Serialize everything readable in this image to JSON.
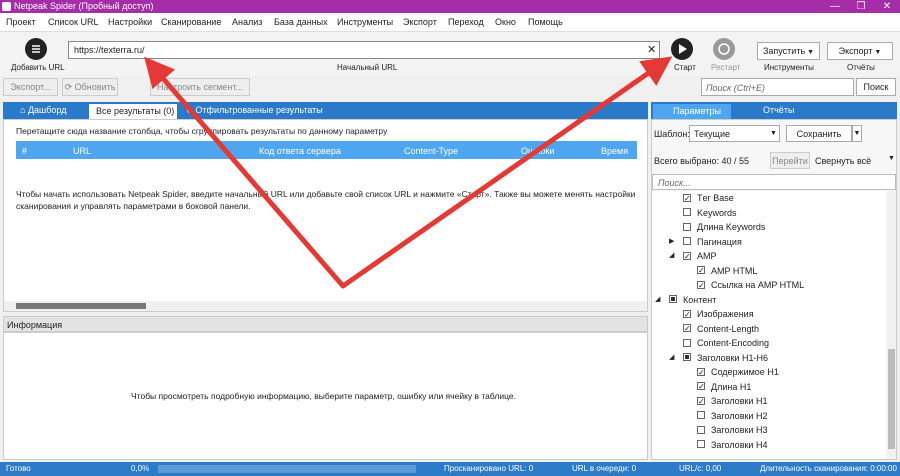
{
  "window": {
    "title": "Netpeak Spider (Пробный доступ)",
    "controls": [
      "—",
      "❐",
      "✕"
    ]
  },
  "menu": [
    "Проект",
    "Список URL",
    "Настройки",
    "Сканирование",
    "Анализ",
    "База данных",
    "Инструменты",
    "Экспорт",
    "Переход",
    "Окно",
    "Помощь"
  ],
  "toolbar": {
    "add_url": "Добавить URL",
    "url_value": "https://texterra.ru/",
    "url_caption": "Начальный URL",
    "start": "Старт",
    "restart": "Рестарт",
    "run": "Запустить",
    "tools": "Инструменты",
    "export": "Экспорт",
    "reports": "Отчёты"
  },
  "sub_toolbar": {
    "export": "Экспорт...",
    "update": "Обновить",
    "configure": "Настроить сегмент..."
  },
  "search": {
    "placeholder": "Поиск (Ctrl+E)",
    "button": "Поиск"
  },
  "left_tabs": {
    "dashboard": "Дашборд",
    "all_results": "Все результаты (0)",
    "filtered": "Отфильтрованные результаты"
  },
  "group_hint": "Перетащите сюда название столбца, чтобы сгруппировать результаты по данному параметру",
  "columns": [
    "#",
    "URL",
    "Код ответа сервера",
    "Content-Type",
    "Ошибки",
    "Время от"
  ],
  "empty_message": "Чтобы начать использовать Netpeak Spider, введите начальный URL или добавьте свой список URL и нажмите «Старт». Также вы можете менять настройки сканирования и управлять параметрами в боковой панели.",
  "info": {
    "title": "Информация",
    "message": "Чтобы просмотреть подробную информацию, выберите параметр, ошибку или ячейку в таблице."
  },
  "right_panel": {
    "tab_params": "Параметры",
    "tab_reports": "Отчёты",
    "template_label": "Шаблон:",
    "template_value": "Текущие",
    "save": "Сохранить",
    "selected": "Всего выбрано: 40 / 55",
    "go": "Перейти",
    "collapse": "Свернуть всё",
    "search_placeholder": "Поиск..."
  },
  "tree": [
    {
      "label": "Tег Base",
      "state": "on",
      "indent": 1,
      "arrow": ""
    },
    {
      "label": "Keywords",
      "state": "off",
      "indent": 1,
      "arrow": ""
    },
    {
      "label": "Длина Keywords",
      "state": "off",
      "indent": 1,
      "arrow": ""
    },
    {
      "label": "Пагинация",
      "state": "off",
      "indent": 1,
      "arrow": "▶"
    },
    {
      "label": "AMP",
      "state": "on",
      "indent": 1,
      "arrow": "◢"
    },
    {
      "label": "AMP HTML",
      "state": "on",
      "indent": 2,
      "arrow": ""
    },
    {
      "label": "Ссылка на AMP HTML",
      "state": "on",
      "indent": 2,
      "arrow": ""
    },
    {
      "label": "Контент",
      "state": "part",
      "indent": 0,
      "arrow": "◢"
    },
    {
      "label": "Изображения",
      "state": "on",
      "indent": 1,
      "arrow": ""
    },
    {
      "label": "Content-Length",
      "state": "on",
      "indent": 1,
      "arrow": ""
    },
    {
      "label": "Content-Encoding",
      "state": "off",
      "indent": 1,
      "arrow": ""
    },
    {
      "label": "Заголовки H1-H6",
      "state": "part",
      "indent": 1,
      "arrow": "◢"
    },
    {
      "label": "Содержимое H1",
      "state": "on",
      "indent": 2,
      "arrow": ""
    },
    {
      "label": "Длина H1",
      "state": "on",
      "indent": 2,
      "arrow": ""
    },
    {
      "label": "Заголовки H1",
      "state": "on",
      "indent": 2,
      "arrow": ""
    },
    {
      "label": "Заголовки H2",
      "state": "off",
      "indent": 2,
      "arrow": ""
    },
    {
      "label": "Заголовки H3",
      "state": "off",
      "indent": 2,
      "arrow": ""
    },
    {
      "label": "Заголовки H4",
      "state": "off",
      "indent": 2,
      "arrow": ""
    }
  ],
  "status": {
    "state": "Готово",
    "progress": "0,0%",
    "scanned": "Просканировано URL: 0",
    "queue": "URL в очереди: 0",
    "speed": "URL/с: 0,00",
    "duration": "Длительность сканирования: 0:00:00"
  },
  "colors": {
    "accent": "#2a7ac9",
    "title": "#a52ea8",
    "arrow": "#e53935"
  }
}
